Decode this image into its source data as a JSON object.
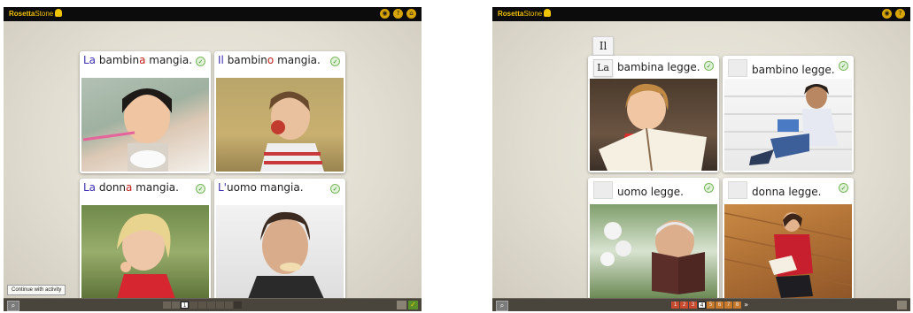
{
  "left": {
    "logo": {
      "brand": "Rosetta",
      "brand2": "Stone"
    },
    "cards": [
      {
        "prefix": "La",
        "pre": " bambin",
        "mark": "a",
        "rest": " mangia."
      },
      {
        "prefix": "Il",
        "pre": " bambin",
        "mark": "o",
        "rest": " mangia."
      },
      {
        "prefix": "La",
        "pre": " donn",
        "mark": "a",
        "rest": " mangia."
      },
      {
        "prefix": "L'",
        "pre": "uomo",
        "mark": "",
        "rest": " mangia."
      }
    ],
    "tooltip": "Continue with activity",
    "progress_steps": [
      "",
      "",
      "1",
      "",
      "",
      "",
      "",
      "",
      ""
    ],
    "icons": {
      "audio": "audio-icon",
      "help": "help-icon",
      "home": "home-icon",
      "check": "check-icon"
    }
  },
  "right": {
    "logo": {
      "brand": "Rosetta",
      "brand2": "Stone"
    },
    "tiles": {
      "il": "Il",
      "la": "La"
    },
    "cards": [
      {
        "text": "bambina legge."
      },
      {
        "text": "bambino legge."
      },
      {
        "text": "uomo legge."
      },
      {
        "text": "donna legge."
      }
    ],
    "progress_steps": [
      "1",
      "2",
      "3",
      "4",
      "5",
      "6",
      "7",
      "8",
      "»"
    ],
    "icons": {
      "audio": "audio-icon",
      "help": "help-icon"
    }
  },
  "colors": {
    "article": "#3c2fb3",
    "ending": "#c0201b",
    "check": "#3e8e2a",
    "logo": "#f2c200"
  }
}
